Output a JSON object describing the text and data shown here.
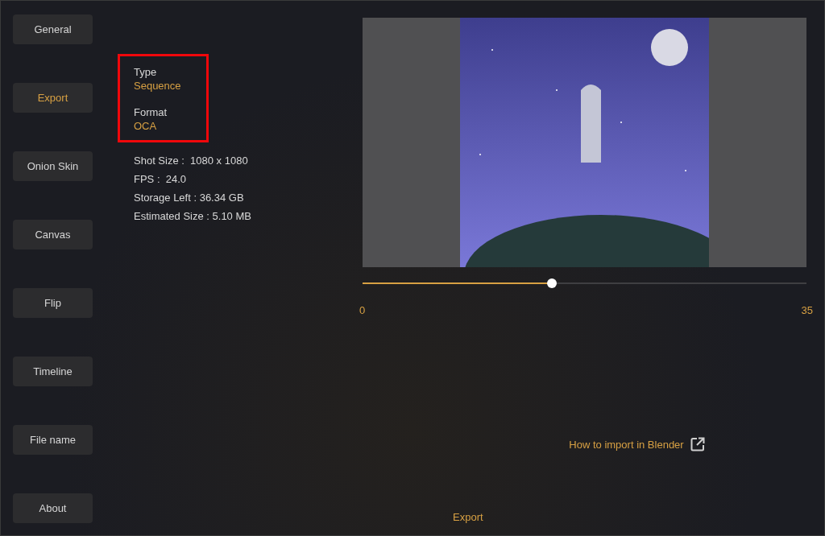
{
  "sidebar": {
    "items": [
      {
        "label": "General",
        "selected": false
      },
      {
        "label": "Export",
        "selected": true
      },
      {
        "label": "Onion Skin",
        "selected": false
      },
      {
        "label": "Canvas",
        "selected": false
      },
      {
        "label": "Flip",
        "selected": false
      },
      {
        "label": "Timeline",
        "selected": false
      },
      {
        "label": "File name",
        "selected": false
      },
      {
        "label": "About",
        "selected": false
      }
    ]
  },
  "settings": {
    "options": [
      {
        "label": "Type",
        "value": "Sequence"
      },
      {
        "label": "Format",
        "value": "OCA"
      }
    ],
    "info": [
      "Shot Size :  1080 x 1080",
      "FPS :  24.0",
      "Storage Left : 36.34 GB",
      "Estimated Size : 5.10 MB"
    ]
  },
  "preview": {
    "slider": {
      "level": 0.427,
      "min_label": "0",
      "max_label": "35"
    }
  },
  "help_link": "How to import in Blender",
  "export_button": "Export"
}
